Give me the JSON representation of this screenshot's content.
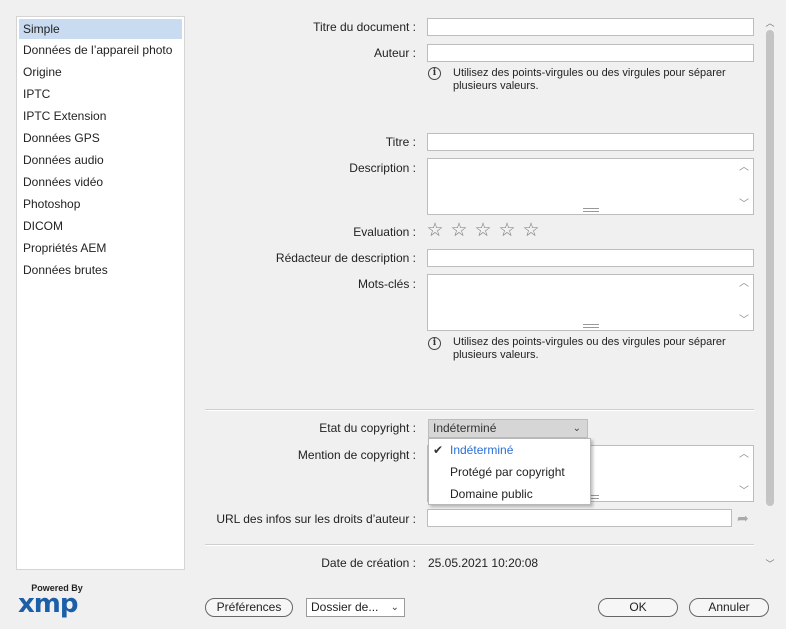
{
  "sidebar": {
    "items": [
      {
        "label": "Simple",
        "selected": true
      },
      {
        "label": "Données de l’appareil photo"
      },
      {
        "label": "Origine"
      },
      {
        "label": "IPTC"
      },
      {
        "label": "IPTC Extension"
      },
      {
        "label": "Données GPS"
      },
      {
        "label": "Données audio"
      },
      {
        "label": "Données vidéo"
      },
      {
        "label": "Photoshop"
      },
      {
        "label": "DICOM"
      },
      {
        "label": "Propriétés AEM"
      },
      {
        "label": "Données brutes"
      }
    ]
  },
  "form": {
    "titre_document": {
      "label": "Titre du document :",
      "value": ""
    },
    "auteur": {
      "label": "Auteur :",
      "value": ""
    },
    "hint": "Utilisez des points-virgules ou des virgules pour séparer plusieurs valeurs.",
    "titre": {
      "label": "Titre :",
      "value": ""
    },
    "description": {
      "label": "Description :",
      "value": ""
    },
    "evaluation": {
      "label": "Evaluation :",
      "stars": 0,
      "max": 5
    },
    "redacteur": {
      "label": "Rédacteur de description :",
      "value": ""
    },
    "mots_cles": {
      "label": "Mots-clés :",
      "value": ""
    },
    "copyright_state": {
      "label": "Etat du copyright :",
      "selected": "Indéterminé",
      "options": [
        "Indéterminé",
        "Protégé par copyright",
        "Domaine public"
      ]
    },
    "copyright_notice": {
      "label": "Mention de copyright :",
      "value": ""
    },
    "copyright_url": {
      "label": "URL des infos sur les droits d’auteur :",
      "value": ""
    },
    "creation_date": {
      "label": "Date de création :",
      "value": "25.05.2021 10:20:08"
    }
  },
  "icons": {
    "info": "i",
    "star": "☆",
    "check": "✔",
    "chevron": "⌄",
    "share": "➦"
  },
  "footer": {
    "powered_by": "Powered By",
    "xmp": "xmp",
    "preferences": "Préférences",
    "folder": "Dossier de...",
    "ok": "OK",
    "cancel": "Annuler"
  },
  "colors": {
    "selection": "#c9dbf1",
    "accent": "#2a6fd6",
    "xmp_blue": "#1c5fa8"
  }
}
